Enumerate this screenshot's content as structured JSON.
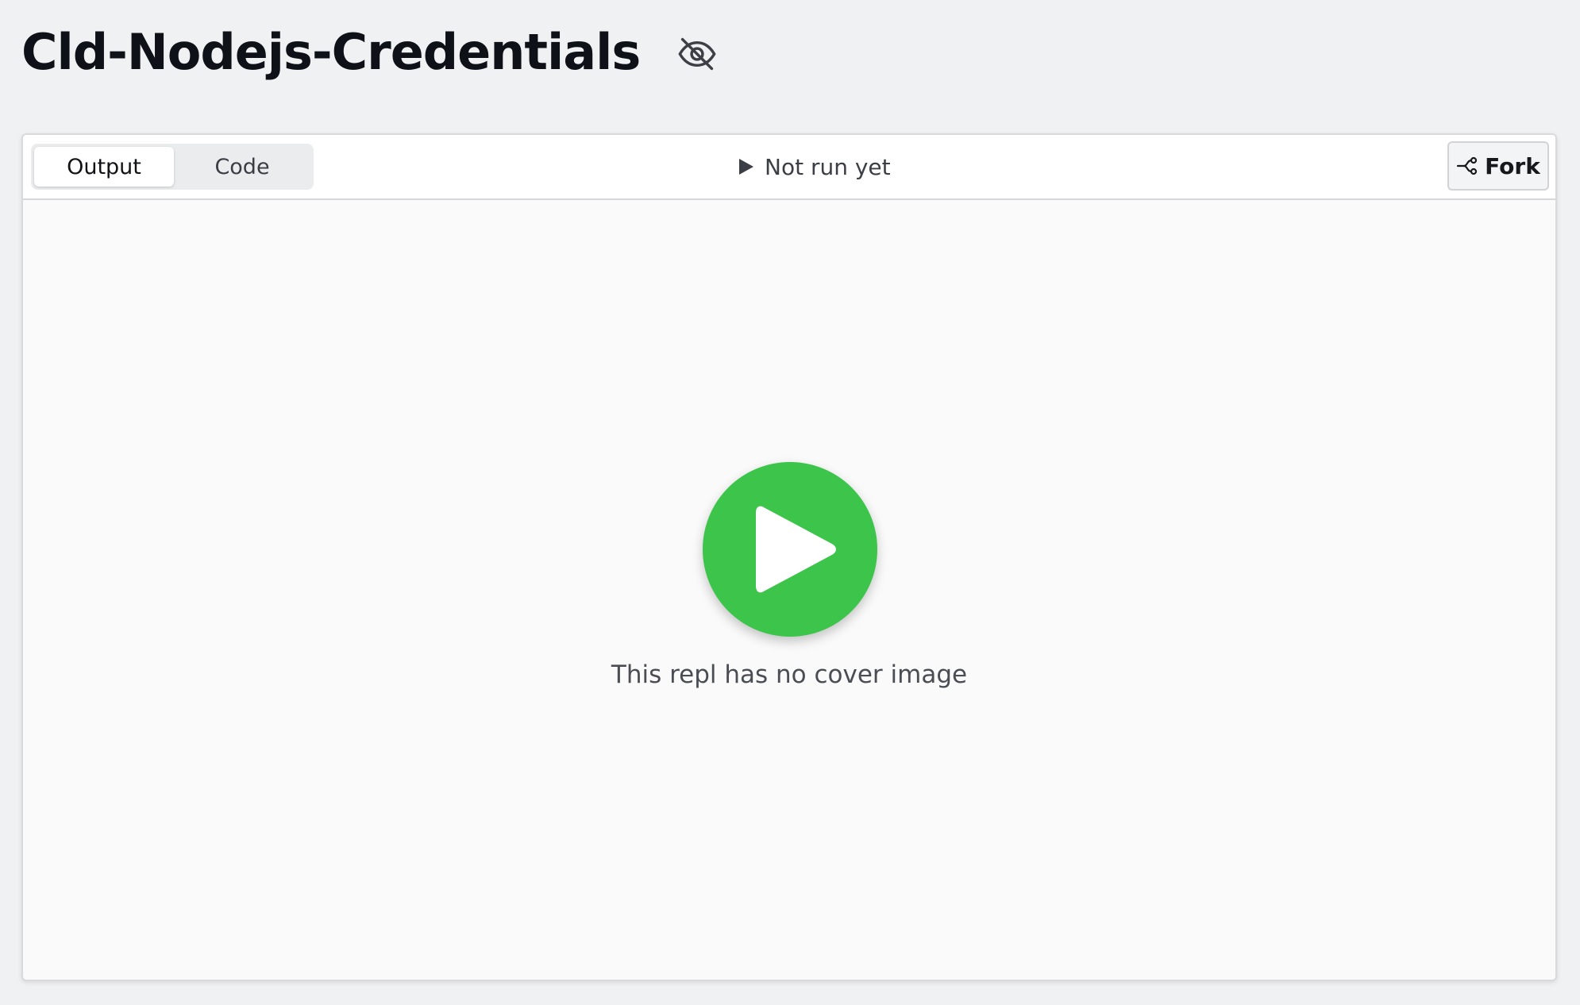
{
  "header": {
    "title": "Cld-Nodejs-Credentials",
    "visibility_icon": "eye-slash-icon"
  },
  "toolbar": {
    "tabs": [
      {
        "label": "Output",
        "active": true
      },
      {
        "label": "Code",
        "active": false
      }
    ],
    "run_status": "Not run yet",
    "run_status_icon": "play-icon",
    "fork_label": "Fork",
    "fork_icon": "fork-icon"
  },
  "main": {
    "play_button_icon": "play-icon",
    "cover_text": "This repl has no cover image",
    "accent_color": "#3dc44b"
  }
}
